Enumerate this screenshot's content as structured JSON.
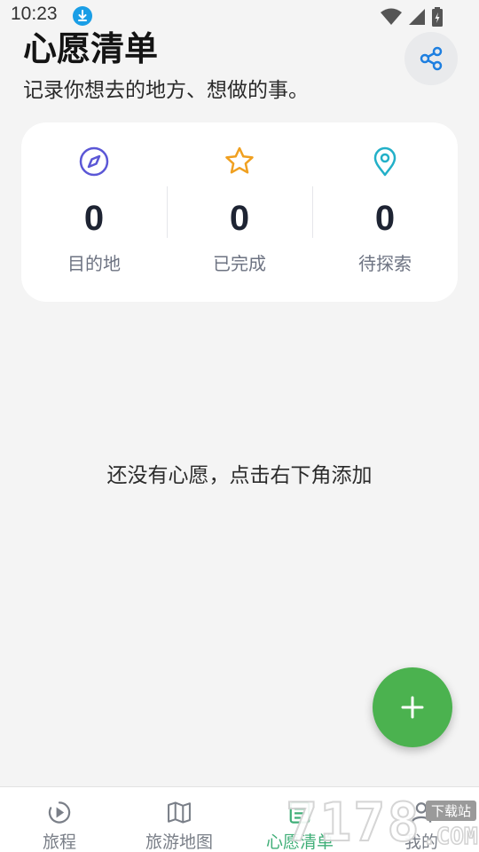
{
  "status_bar": {
    "time": "10:23"
  },
  "header": {
    "title": "心愿清单",
    "subtitle": "记录你想去的地方、想做的事。"
  },
  "stats": [
    {
      "value": "0",
      "label": "目的地",
      "icon": "compass-icon",
      "color": "#5b57d6"
    },
    {
      "value": "0",
      "label": "已完成",
      "icon": "star-icon",
      "color": "#f0a020"
    },
    {
      "value": "0",
      "label": "待探索",
      "icon": "location-pin-icon",
      "color": "#22b0c8"
    }
  ],
  "empty_state": {
    "text": "还没有心愿，点击右下角添加"
  },
  "bottom_nav": [
    {
      "label": "旅程",
      "icon": "journey-icon",
      "active": false
    },
    {
      "label": "旅游地图",
      "icon": "map-icon",
      "active": false
    },
    {
      "label": "心愿清单",
      "icon": "wishlist-icon",
      "active": true
    },
    {
      "label": "我的",
      "icon": "profile-icon",
      "active": false
    }
  ],
  "watermark": {
    "text": "7178",
    "badge": "下载站",
    "domain": ".COM"
  },
  "colors": {
    "accent": "#4bb24f",
    "nav_active": "#3fae77",
    "background": "#f4f4f4"
  }
}
